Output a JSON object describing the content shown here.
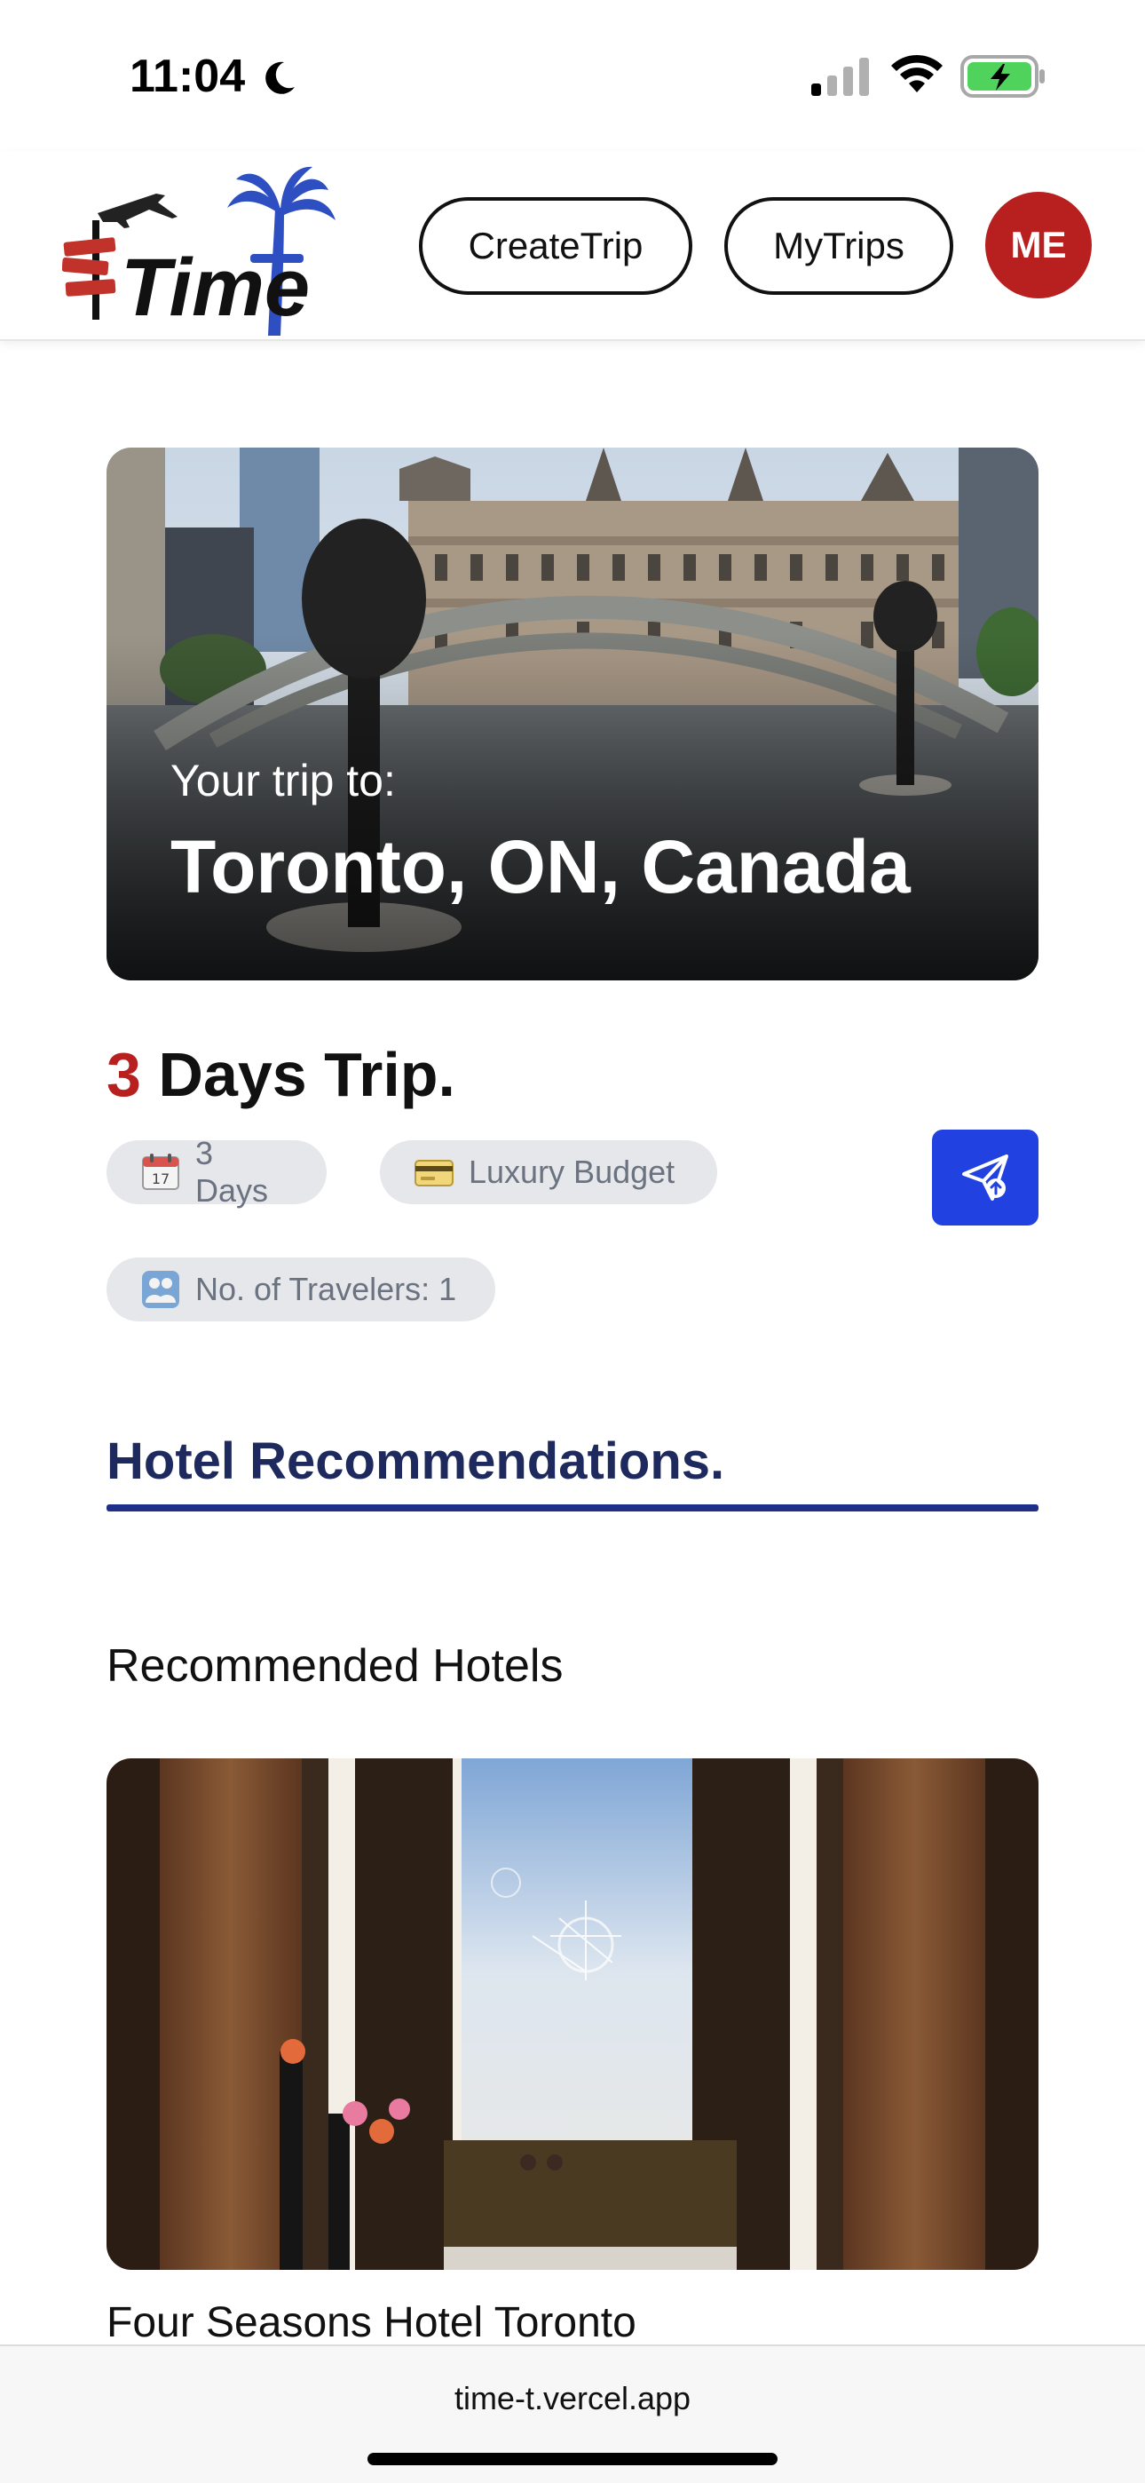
{
  "status_bar": {
    "time": "11:04",
    "icons": [
      "moon-icon",
      "cellular-signal-icon",
      "wifi-icon",
      "battery-charging-icon"
    ]
  },
  "header": {
    "logo_text": "Time",
    "create_trip_label": "CreateTrip",
    "my_trips_label": "MyTrips",
    "avatar_initials": "ME"
  },
  "hero": {
    "subtitle": "Your trip to:",
    "destination": "Toronto, ON, Canada"
  },
  "trip": {
    "days_number": "3",
    "days_suffix": " Days Trip.",
    "chips": {
      "days": "3 Days",
      "budget": "Luxury Budget",
      "travelers": "No. of Travelers: 1"
    }
  },
  "sections": {
    "hotel_title": "Hotel Recommendations.",
    "hotels_subheading": "Recommended Hotels"
  },
  "hotels": [
    {
      "name": "Four Seasons Hotel Toronto"
    }
  ],
  "browser": {
    "url": "time-t.vercel.app"
  },
  "colors": {
    "accent_red": "#b8201f",
    "share_blue": "#2141e0",
    "section_navy": "#1e2a5e",
    "chip_gray": "#e5e7eb"
  }
}
